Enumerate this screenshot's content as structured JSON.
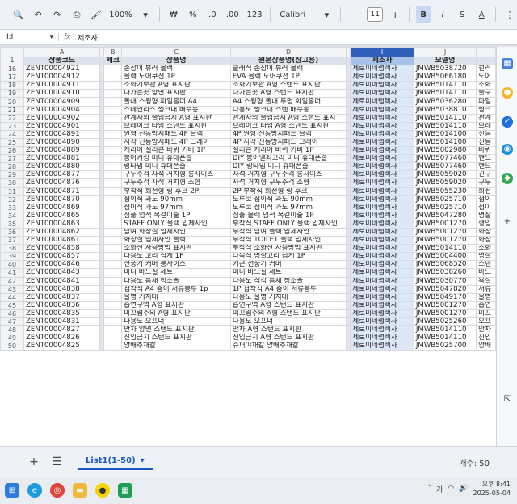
{
  "toolbar": {
    "zoom": "100%",
    "currency": "₩",
    "percent": "%",
    "dec_decrease": ".0",
    "dec_increase": ".00",
    "number_format": "123",
    "font": "Calibri",
    "font_size": "11",
    "bold": "B",
    "italic": "I",
    "strike": "S",
    "text_color": "A"
  },
  "formula_bar": {
    "cell_ref": "I:I",
    "fx": "fx",
    "content": "제조사"
  },
  "columns": [
    "A",
    "B",
    "C",
    "D",
    "I",
    "J"
  ],
  "header": {
    "row": "1",
    "cells": [
      "상품코드",
      "제크",
      "상품명",
      "원본상품명(참고용)",
      "제조사",
      "모델명"
    ]
  },
  "rows": [
    {
      "n": "16",
      "c": [
        "ZENT00004921",
        "",
        "손잡이 뷰러 블랙",
        "클래식 손잡이 뷰러 블랙",
        "제로미네랩렉사",
        "JMWB5038720",
        "컬러"
      ]
    },
    {
      "n": "17",
      "c": [
        "ZENT00004912",
        "",
        "블랙 도어쿠션 1P",
        "EVA 블랙 도어쿠션 1P",
        "제로미네랩렉사",
        "JMWB5066180",
        "도어"
      ]
    },
    {
      "n": "18",
      "c": [
        "ZENT00004911",
        "",
        "소화기보관 A형 표지판",
        "소화기보관 A형 스탠드 표지판",
        "제로미네랩렉사",
        "JMWB5014110",
        "소화"
      ]
    },
    {
      "n": "19",
      "c": [
        "ZENT00004910",
        "",
        "나가는곳 양면 표지판",
        "나가는곳 A형 스탠드 표지판",
        "제로미네랩렉사",
        "JMWB5014110",
        "출구"
      ]
    },
    {
      "n": "20",
      "c": [
        "ZENT00004909",
        "",
        "폴대 스윙형 파일홀더 A4",
        "A4 스윙형 폴대 투명 화일홀더",
        "제로미네랩렉사",
        "JMWB5036280",
        "파일"
      ]
    },
    {
      "n": "21",
      "c": [
        "ZENT00004904",
        "",
        "스테인리스 씽크대 배수통",
        "다용도 씽크대 스텐 배수통",
        "제로미네랩렉사",
        "JMWB5038810",
        "씽크"
      ]
    },
    {
      "n": "22",
      "c": [
        "ZENT00004902",
        "",
        "관계자외 출입금지 A형 표지판",
        "관계자외 출입금지 A형 스탠드 표지",
        "제로미네랩렉사",
        "JMWB5014110",
        "관계"
      ]
    },
    {
      "n": "23",
      "c": [
        "ZENT00004901",
        "",
        "브레이크 타임 스탠드 표지판",
        "브레이크 타임 A형 스탠드 표지판",
        "제로미네랩렉사",
        "JMWB5014110",
        "브레"
      ]
    },
    {
      "n": "24",
      "c": [
        "ZENT00004891",
        "",
        "원형 진동방지패드 4P 블랙",
        "4P 원형 진동방지패드 블랙",
        "제로미네랩렉사",
        "JMWB5014100",
        "진동"
      ]
    },
    {
      "n": "25",
      "c": [
        "ZENT00004890",
        "",
        "사각 진동방지패드 4P 그레이",
        "4P 사각 진동방지패드 그레이",
        "제로미네랩렉사",
        "JMWB5014100",
        "진동"
      ]
    },
    {
      "n": "26",
      "c": [
        "ZENT00004889",
        "",
        "캐리어 실리콘 바퀴 커버 1P",
        "실리콘 캐리어 바퀴 커버 1P",
        "제로미네랩렉사",
        "JMWB5002980",
        "바퀴"
      ]
    },
    {
      "n": "27",
      "c": [
        "ZENT00004881",
        "",
        "붕어키링 미니 휴대폰줄",
        "DIY 붕어열쇠고리 미니 휴대폰줄",
        "제로미네랩렉사",
        "JMWB5077460",
        "핸드"
      ]
    },
    {
      "n": "28",
      "c": [
        "ZENT00004880",
        "",
        "링타입 미니 휴대폰줄",
        "DIY 링타입 미니 휴대폰줄",
        "제로미네랩렉사",
        "JMWB5077460",
        "핸드"
      ]
    },
    {
      "n": "29",
      "c": [
        "ZENT00004877",
        "",
        "구두주걱 자석 거치형 롱사이즈",
        "자석 거치형 구두주걱 롱사이즈",
        "제로미네랩렉사",
        "JMWB5059020",
        "긴구"
      ]
    },
    {
      "n": "30",
      "c": [
        "ZENT00004876",
        "",
        "구두주걱 자석 거치형 소형",
        "자석 거치형 구두주걱 소형",
        "제로미네랩렉사",
        "JMWB5059020",
        "구두"
      ]
    },
    {
      "n": "31",
      "c": [
        "ZENT00004871",
        "",
        "부착식 회전형 링 후크 2P",
        "2P 부착식 회전형 링 후크",
        "제로미네랩렉사",
        "JMWB5055230",
        "회전"
      ]
    },
    {
      "n": "32",
      "c": [
        "ZENT00004870",
        "",
        "접이식 과도 90mm",
        "도루코 접이식 과도 90mm",
        "제로미네랩렉사",
        "JMWB5025710",
        "접이"
      ]
    },
    {
      "n": "33",
      "c": [
        "ZENT00004869",
        "",
        "접이식 과도 97mm",
        "도루코 접이식 과도 97mm",
        "제로미네랩렉사",
        "JMWB5025710",
        "접이"
      ]
    },
    {
      "n": "34",
      "c": [
        "ZENT00004865",
        "",
        "심플 넙적 목걸이줄 1P",
        "심플 블랙 넙적 목걸이줄 1P",
        "제로미네랩렉사",
        "JMWB5047280",
        "명찰"
      ]
    },
    {
      "n": "35",
      "c": [
        "ZENT00004863",
        "",
        "STAFF ONLY 블랙 입체사인",
        "부착식 STAFF ONLY 블랙 입체사인",
        "제로미네랩렉사",
        "JMWB5001270",
        "행잉"
      ]
    },
    {
      "n": "36",
      "c": [
        "ZENT00004862",
        "",
        "남여 화장실 입체사인",
        "부착식 남여 블랙 입체사인",
        "제로미네랩렉사",
        "JMWB5001270",
        "화장"
      ]
    },
    {
      "n": "37",
      "c": [
        "ZENT00004861",
        "",
        "화장실 입체사인 블랙",
        "부착식 TOILET 블랙 입체사인",
        "제로미네랩렉사",
        "JMWB5001270",
        "화장"
      ]
    },
    {
      "n": "38",
      "c": [
        "ZENT00004858",
        "",
        "소화전 사용방법 표지판",
        "부착식 소화전 사용방법 표지판",
        "제로미네랩렉사",
        "JMWB5014110",
        "소화"
      ]
    },
    {
      "n": "39",
      "c": [
        "ZENT00004857",
        "",
        "다용도 고리 집게 1P",
        "다목적 명찰고리 집게 1P",
        "제로미네랩렉사",
        "JMWB5004400",
        "명찰"
      ]
    },
    {
      "n": "40",
      "c": [
        "ZENT00004846",
        "",
        "선풍기 커버 롱사이즈",
        "키큰 선풍기 커버",
        "제로미네랩렉사",
        "JMWB5068520",
        "스탠"
      ]
    },
    {
      "n": "41",
      "c": [
        "ZENT00004843",
        "",
        "미니 바느질 세트",
        "미니 바느질 세트",
        "제로미네랩렉사",
        "JMWB5038260",
        "바느"
      ]
    },
    {
      "n": "42",
      "c": [
        "ZENT00004841",
        "",
        "다용도 틈새 청소솔",
        "다용도 직각 틈새 청소솔",
        "제로미네랩렉사",
        "JMWB5030770",
        "욕실"
      ]
    },
    {
      "n": "43",
      "c": [
        "ZENT00004838",
        "",
        "접착식 A4 종이 서류봉투 1p",
        "1P 접착식 A4 종이 서류봉투",
        "제로미네랩렉사",
        "JMWB5047820",
        "서류"
      ]
    },
    {
      "n": "44",
      "c": [
        "ZENT00004837",
        "",
        "물병 거치대",
        "다용도 물병 거치대",
        "제로미네랩렉사",
        "JMWB5049170",
        "물병"
      ]
    },
    {
      "n": "45",
      "c": [
        "ZENT00004836",
        "",
        "흡연구역 A형 표지판",
        "흡연구역 A형 스탠드 표지판",
        "제로미네랩렉사",
        "JMWB5001270",
        "흡연"
      ]
    },
    {
      "n": "46",
      "c": [
        "ZENT00004835",
        "",
        "미끄럼주의 A형 표지판",
        "미끄럼주의 A형 스탠드 표지판",
        "제로미네랩렉사",
        "JMWB5001270",
        "미끄"
      ]
    },
    {
      "n": "47",
      "c": [
        "ZENT00004831",
        "",
        "다용도 오프너",
        "다용도 오프너",
        "제로미네랩렉사",
        "JMWB5025260",
        "오프"
      ]
    },
    {
      "n": "48",
      "c": [
        "ZENT00004827",
        "",
        "만차 양면 스탠드 표지판",
        "만차 A형 스탠드 표지판",
        "제로미네랩렉사",
        "JMWB5014110",
        "만차"
      ]
    },
    {
      "n": "49",
      "c": [
        "ZENT00004826",
        "",
        "진입금지 스탠드 표지판",
        "진입금지 A형 스탠드 표지판",
        "제로미네랩렉사",
        "JMWB5014110",
        "진입"
      ]
    },
    {
      "n": "50",
      "c": [
        "ZENT00004825",
        "",
        "양배추채칼",
        "슈퍼야채칼 양배추채칼",
        "제로미네랩렉사",
        "JMWB5025700",
        "양배"
      ]
    }
  ],
  "sheet_bar": {
    "add": "+",
    "menu": "☰",
    "tab_label": "List1(1-50)",
    "count_label": "개수: 50"
  },
  "tray": {
    "ime": "가",
    "time": "오후 8:41",
    "date": "2025-05-04"
  },
  "colors": {
    "selected_header": "#2f5fb8",
    "selected_column": "#dce7f8",
    "header_row": "#dde3ec",
    "accent": "#1a56c4"
  }
}
